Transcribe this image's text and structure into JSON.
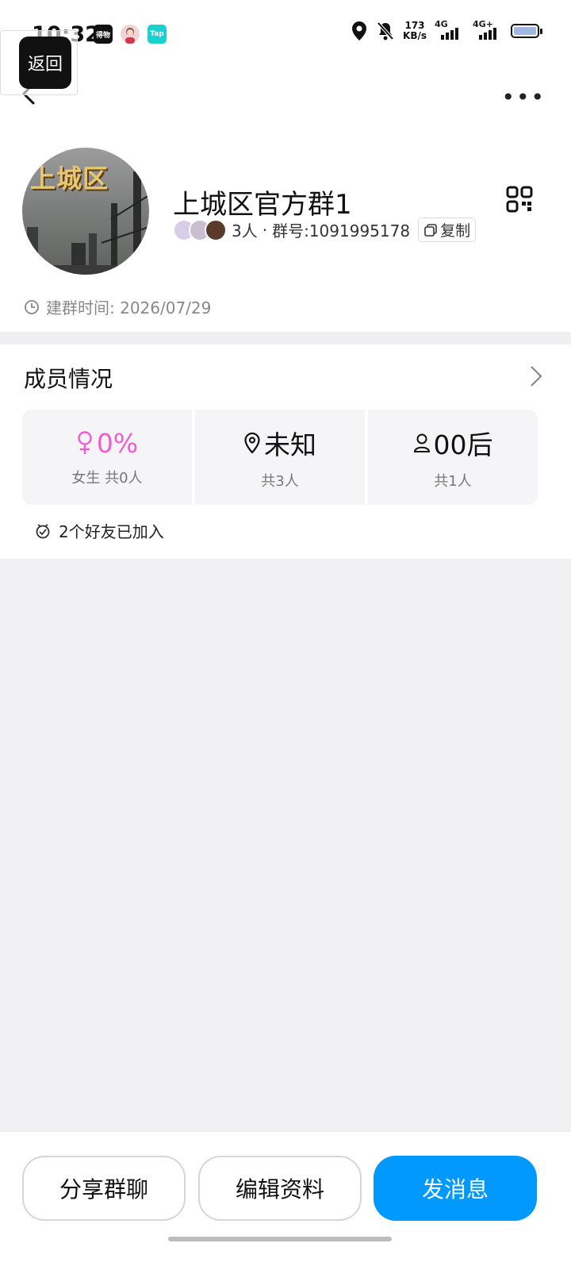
{
  "status_bar": {
    "time": "10:32",
    "app_icons": [
      "得物",
      "",
      "Tap"
    ],
    "net_speed_value": "173",
    "net_speed_unit": "KB/s",
    "signal1_label": "4G",
    "signal2_label": "4G+"
  },
  "overlay": {
    "back_label": "返回"
  },
  "header": {
    "group_name": "上城区官方群1",
    "avatar_text": "上城区",
    "member_count": "3人",
    "separator": "·",
    "group_id": "群号:1091995178",
    "copy_label": "复制",
    "created_label": "建群时间: 2026/07/29"
  },
  "members": {
    "title": "成员情况",
    "stats": [
      {
        "main": "0%",
        "sub": "女生 共0人",
        "icon": "female-icon"
      },
      {
        "main": "未知",
        "sub": "共3人",
        "icon": "location-pin-icon"
      },
      {
        "main": "00后",
        "sub": "共1人",
        "icon": "person-icon"
      }
    ],
    "friends_joined": "2个好友已加入"
  },
  "actions": {
    "share_label": "分享群聊",
    "edit_label": "编辑资料",
    "message_label": "发消息"
  },
  "colors": {
    "primary": "#0099ff",
    "female_accent": "#f15bd0",
    "page_bg": "#f0f0f2"
  }
}
